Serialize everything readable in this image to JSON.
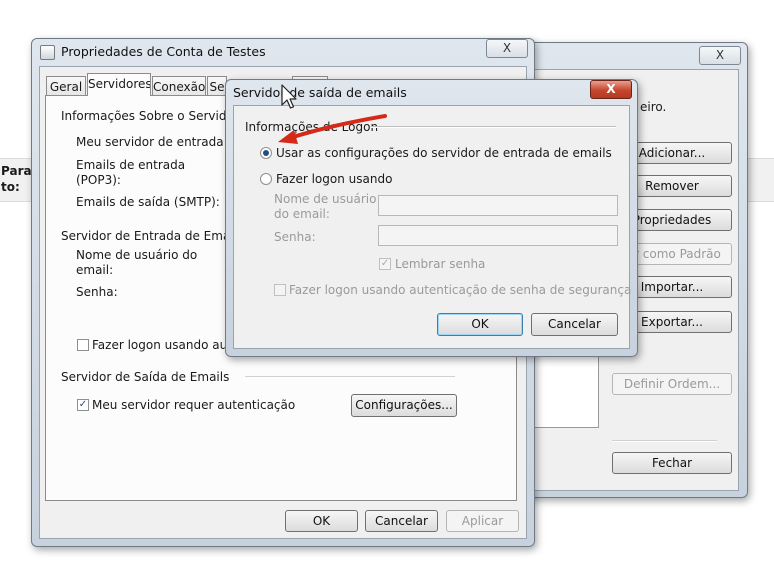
{
  "background": {
    "to_label": "Para:",
    "cc_label": "to:"
  },
  "accounts_window": {
    "close_label": "X",
    "text_fragment": "eiro.",
    "buttons": {
      "add": "Adicionar...",
      "remove": "Remover",
      "properties": "Propriedades",
      "set_default": "nir como Padrão",
      "import": "Importar...",
      "export": "Exportar...",
      "set_order": "Definir Ordem...",
      "close": "Fechar"
    }
  },
  "props_window": {
    "title": "Propriedades de Conta de Testes",
    "close_label": "X",
    "tabs": [
      "Geral",
      "Servidores",
      "Conexão",
      "Se"
    ],
    "server_info_heading": "Informações Sobre o Servidor",
    "incoming_server_label": "Meu servidor de entrada de e",
    "incoming_emails_label_1": "Emails de entrada",
    "incoming_emails_label_2": "(POP3):",
    "outgoing_emails_label": "Emails de saída (SMTP):",
    "incoming_server_heading": "Servidor de Entrada de Emails",
    "username_label_1": "Nome de usuário do",
    "username_label_2": "email:",
    "password_label": "Senha:",
    "logon_auth_label": "Fazer logon usando auten",
    "outgoing_server_heading": "Servidor de Saída de Emails",
    "requires_auth_label": "Meu servidor requer autenticação",
    "requires_auth_checked": true,
    "settings_button": "Configurações...",
    "ok_button": "OK",
    "cancel_button": "Cancelar",
    "apply_button": "Aplicar"
  },
  "smtp_dialog": {
    "title": "Servidor de saída de emails",
    "close_label": "X",
    "group_heading": "Informações de Logon",
    "option_use_incoming": "Usar as configurações do servidor de entrada de emails",
    "option_logon_using": "Fazer logon usando",
    "selected_option": "use_incoming",
    "username_label_1": "Nome de usuário",
    "username_label_2": "do email:",
    "username_value": "",
    "password_label": "Senha:",
    "password_value": "",
    "remember_password_label": "Lembrar senha",
    "remember_password_checked": true,
    "spa_label": "Fazer logon usando autenticação de senha de segurança",
    "ok_button": "OK",
    "cancel_button": "Cancelar"
  },
  "colors": {
    "close_red": "#c6452e",
    "accent_blue": "#1f4f85",
    "annotation_arrow": "#d42a1a"
  }
}
